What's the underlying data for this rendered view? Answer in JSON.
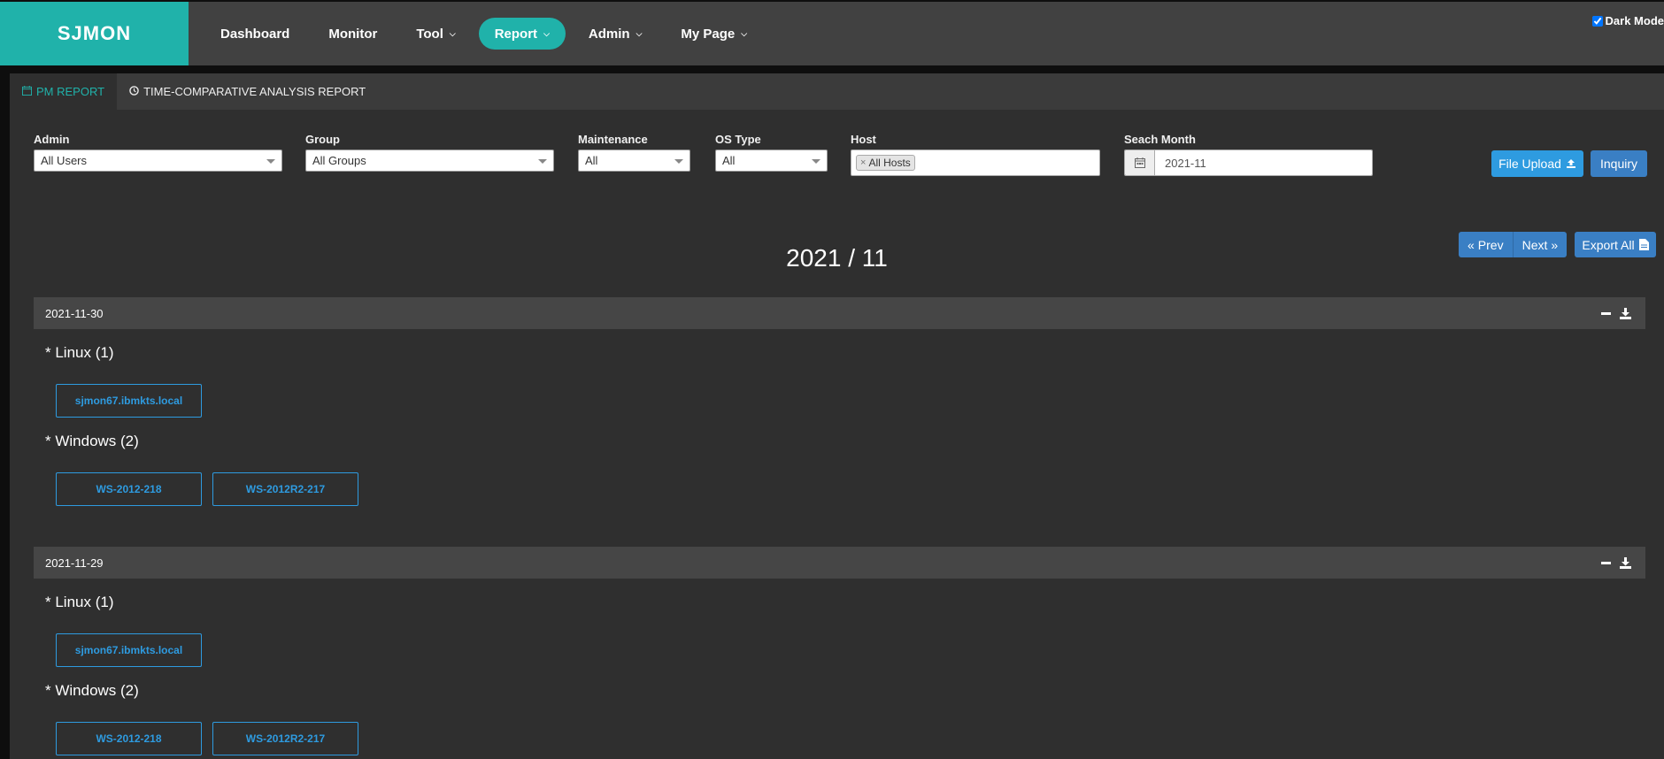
{
  "brand": "SJMON",
  "nav": [
    {
      "label": "Dashboard",
      "dropdown": false,
      "active": false
    },
    {
      "label": "Monitor",
      "dropdown": false,
      "active": false
    },
    {
      "label": "Tool",
      "dropdown": true,
      "active": false
    },
    {
      "label": "Report",
      "dropdown": true,
      "active": true
    },
    {
      "label": "Admin",
      "dropdown": true,
      "active": false
    },
    {
      "label": "My Page",
      "dropdown": true,
      "active": false
    }
  ],
  "dark_mode": {
    "label": "Dark Mode",
    "checked": true
  },
  "tabs": [
    {
      "label": "PM REPORT",
      "icon": "calendar-icon",
      "active": true
    },
    {
      "label": "TIME-COMPARATIVE ANALYSIS REPORT",
      "icon": "clock-icon",
      "active": false
    }
  ],
  "filters": {
    "admin": {
      "label": "Admin",
      "value": "All Users"
    },
    "group": {
      "label": "Group",
      "value": "All Groups"
    },
    "maintenance": {
      "label": "Maintenance",
      "value": "All"
    },
    "os_type": {
      "label": "OS Type",
      "value": "All"
    },
    "host": {
      "label": "Host",
      "chip": "All Hosts"
    },
    "month": {
      "label": "Seach Month",
      "value": "2021-11"
    }
  },
  "buttons": {
    "file_upload": "File Upload",
    "inquiry": "Inquiry",
    "prev": "Prev",
    "next": "Next",
    "export_all": "Export All"
  },
  "month_title": "2021 / 11",
  "days": [
    {
      "date": "2021-11-30",
      "linux_label": "* Linux (1)",
      "linux_hosts": [
        "sjmon67.ibmkts.local"
      ],
      "windows_label": "* Windows (2)",
      "windows_hosts": [
        "WS-2012-218",
        "WS-2012R2-217"
      ]
    },
    {
      "date": "2021-11-29",
      "linux_label": "* Linux (1)",
      "linux_hosts": [
        "sjmon67.ibmkts.local"
      ],
      "windows_label": "* Windows (2)",
      "windows_hosts": [
        "WS-2012-218",
        "WS-2012R2-217"
      ]
    }
  ],
  "colors": {
    "brand": "#20b2aa",
    "accent_blue": "#2e9be0",
    "button_blue": "#3a7fc4",
    "panel_bg": "#2f2f2f",
    "navbar_bg": "#414141"
  }
}
